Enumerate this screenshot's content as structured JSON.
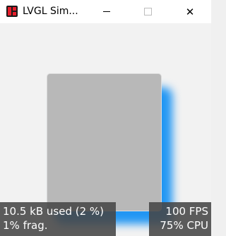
{
  "window": {
    "title": "LVGL Sim...",
    "icon": "lvgl-logo-icon",
    "controls": {
      "minimize_icon": "minimize-icon",
      "maximize_icon": "maximize-icon",
      "close_icon": "close-icon",
      "close_glyph": "✕"
    }
  },
  "colors": {
    "shadow": "#2196f3",
    "box": "#b8b8b8",
    "overlay": "#464646"
  },
  "monitors": {
    "memory": {
      "line1": "10.5 kB used (2 %)",
      "line2": "1% frag."
    },
    "performance": {
      "line1": "100 FPS",
      "line2": "75% CPU"
    }
  }
}
